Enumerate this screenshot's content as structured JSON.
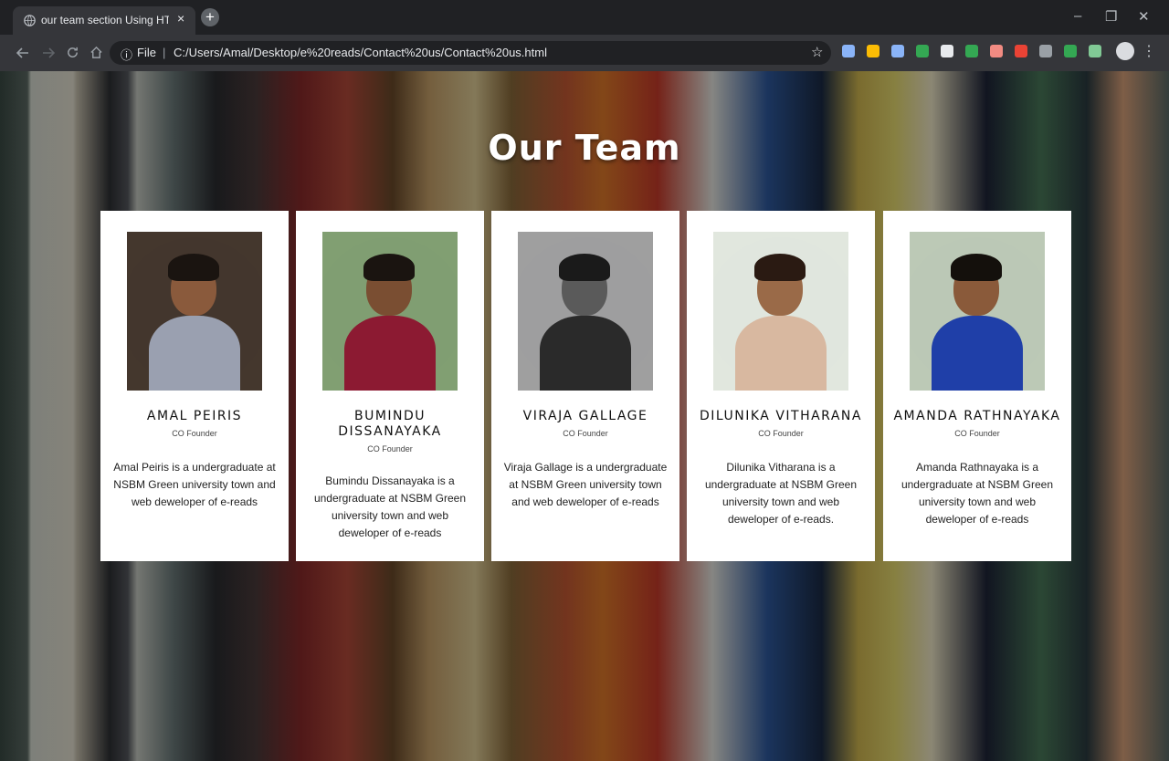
{
  "browser": {
    "tab_title": "our team section Using HTML an",
    "tab_close": "×",
    "new_tab": "+",
    "url_prefix": "File",
    "url_separator": "|",
    "url": "C:/Users/Amal/Desktop/e%20reads/Contact%20us/Contact%20us.html",
    "window_controls": [
      "–",
      "❐",
      "✕"
    ],
    "nav_icons": [
      "back-icon",
      "forward-icon",
      "reload-icon",
      "home-icon"
    ],
    "extension_colors": [
      "#8ab4f8",
      "#fbbc04",
      "#8ab4f8",
      "#34a853",
      "#e8eaed",
      "#34a853",
      "#f28b82",
      "#ea4335",
      "#9aa0a6",
      "#34a853",
      "#81c995"
    ]
  },
  "page": {
    "title": "Our Team"
  },
  "team": [
    {
      "name": "AMAL PEIRIS",
      "role": "CO Founder",
      "description": "Amal Peiris is a undergraduate at NSBM Green university town and web deweloper of e-reads",
      "photo_colors": {
        "bg": "#3a2c22",
        "skin": "#8a5a3c",
        "hair": "#1a1410",
        "shirt": "#9aa0b0"
      }
    },
    {
      "name": "BUMINDU DISSANAYAKA",
      "role": "CO Founder",
      "description": "Bumindu Dissanayaka is a undergraduate at NSBM Green university town and web deweloper of e-reads",
      "photo_colors": {
        "bg": "#7a9a6a",
        "skin": "#7a4e32",
        "hair": "#1a1410",
        "shirt": "#8c1a32"
      }
    },
    {
      "name": "VIRAJA GALLAGE",
      "role": "CO Founder",
      "description": "Viraja Gallage is a undergraduate at NSBM Green university town and web deweloper of e-reads",
      "photo_colors": {
        "bg": "#9a9a9a",
        "skin": "#5a5a5a",
        "hair": "#1a1a1a",
        "shirt": "#2a2a2a"
      }
    },
    {
      "name": "DILUNIKA VITHARANA",
      "role": "CO Founder",
      "description": "Dilunika Vitharana is a undergraduate at NSBM Green university town and web deweloper of e-reads.",
      "photo_colors": {
        "bg": "#dfe6dc",
        "skin": "#9a6a48",
        "hair": "#2a1a12",
        "shirt": "#d8b8a0"
      }
    },
    {
      "name": "AMANDA RATHNAYAKA",
      "role": "CO Founder",
      "description": "Amanda Rathnayaka is a undergraduate at NSBM Green university town and web deweloper of e-reads",
      "photo_colors": {
        "bg": "#b8c6b2",
        "skin": "#8a5a3a",
        "hair": "#14100c",
        "shirt": "#1f3fa8"
      }
    }
  ]
}
